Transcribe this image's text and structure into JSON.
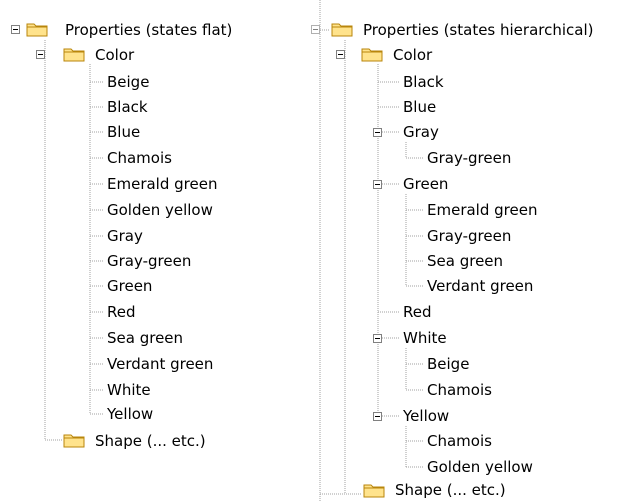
{
  "left_tree": {
    "root": "Properties (states flat)",
    "color": "Color",
    "items": [
      "Beige",
      "Black",
      "Blue",
      "Chamois",
      "Emerald green",
      "Golden yellow",
      "Gray",
      "Gray-green",
      "Green",
      "Red",
      "Sea green",
      "Verdant green",
      "White",
      "Yellow"
    ],
    "shape": "Shape (... etc.)"
  },
  "right_tree": {
    "root": "Properties (states hierarchical)",
    "color": "Color",
    "black": "Black",
    "blue": "Blue",
    "gray": "Gray",
    "gray_children": [
      "Gray-green"
    ],
    "green": "Green",
    "green_children": [
      "Emerald green",
      "Gray-green",
      "Sea green",
      "Verdant green"
    ],
    "red": "Red",
    "white": "White",
    "white_children": [
      "Beige",
      "Chamois"
    ],
    "yellow": "Yellow",
    "yellow_children": [
      "Chamois",
      "Golden yellow"
    ],
    "shape": "Shape (... etc.)"
  },
  "colors": {
    "folder_fill": "#FFE38C",
    "folder_outline": "#B8860B",
    "tree_lines": "#A0A0A0"
  }
}
